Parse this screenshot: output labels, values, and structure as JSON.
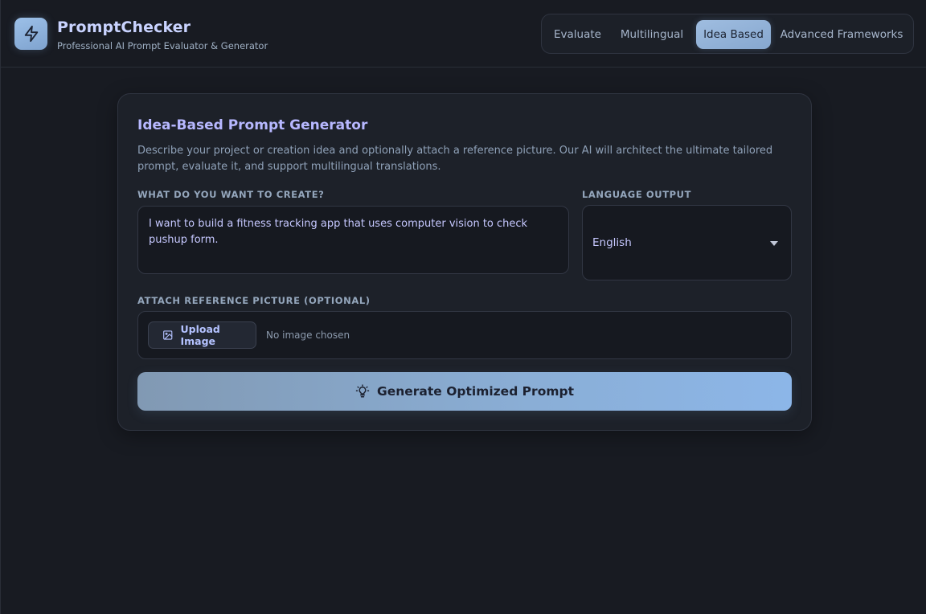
{
  "app": {
    "title": "PromptChecker",
    "subtitle": "Professional AI Prompt Evaluator & Generator",
    "logo_icon": "lightning-icon"
  },
  "nav": {
    "tabs": [
      {
        "label": "Evaluate",
        "active": false
      },
      {
        "label": "Multilingual",
        "active": false
      },
      {
        "label": "Idea Based",
        "active": true
      },
      {
        "label": "Advanced Frameworks",
        "active": false
      }
    ]
  },
  "card": {
    "title": "Idea-Based Prompt Generator",
    "description": "Describe your project or creation idea and optionally attach a reference picture. Our AI will architect the ultimate tailored prompt, evaluate it, and support multilingual translations."
  },
  "idea": {
    "label": "WHAT DO YOU WANT TO CREATE?",
    "value": "I want to build a fitness tracking app that uses computer vision to check pushup form."
  },
  "language": {
    "label": "LANGUAGE OUTPUT",
    "selected": "English"
  },
  "attach": {
    "label": "ATTACH REFERENCE PICTURE (OPTIONAL)",
    "button_label": "Upload Image",
    "status": "No image chosen",
    "icon": "image-icon"
  },
  "generate": {
    "label": "Generate Optimized Prompt",
    "icon": "lightbulb-icon"
  },
  "colors": {
    "background": "#181b22",
    "card": "#1d2129",
    "accent": "#8cb6e8",
    "title_accent": "#b7b8ff"
  }
}
